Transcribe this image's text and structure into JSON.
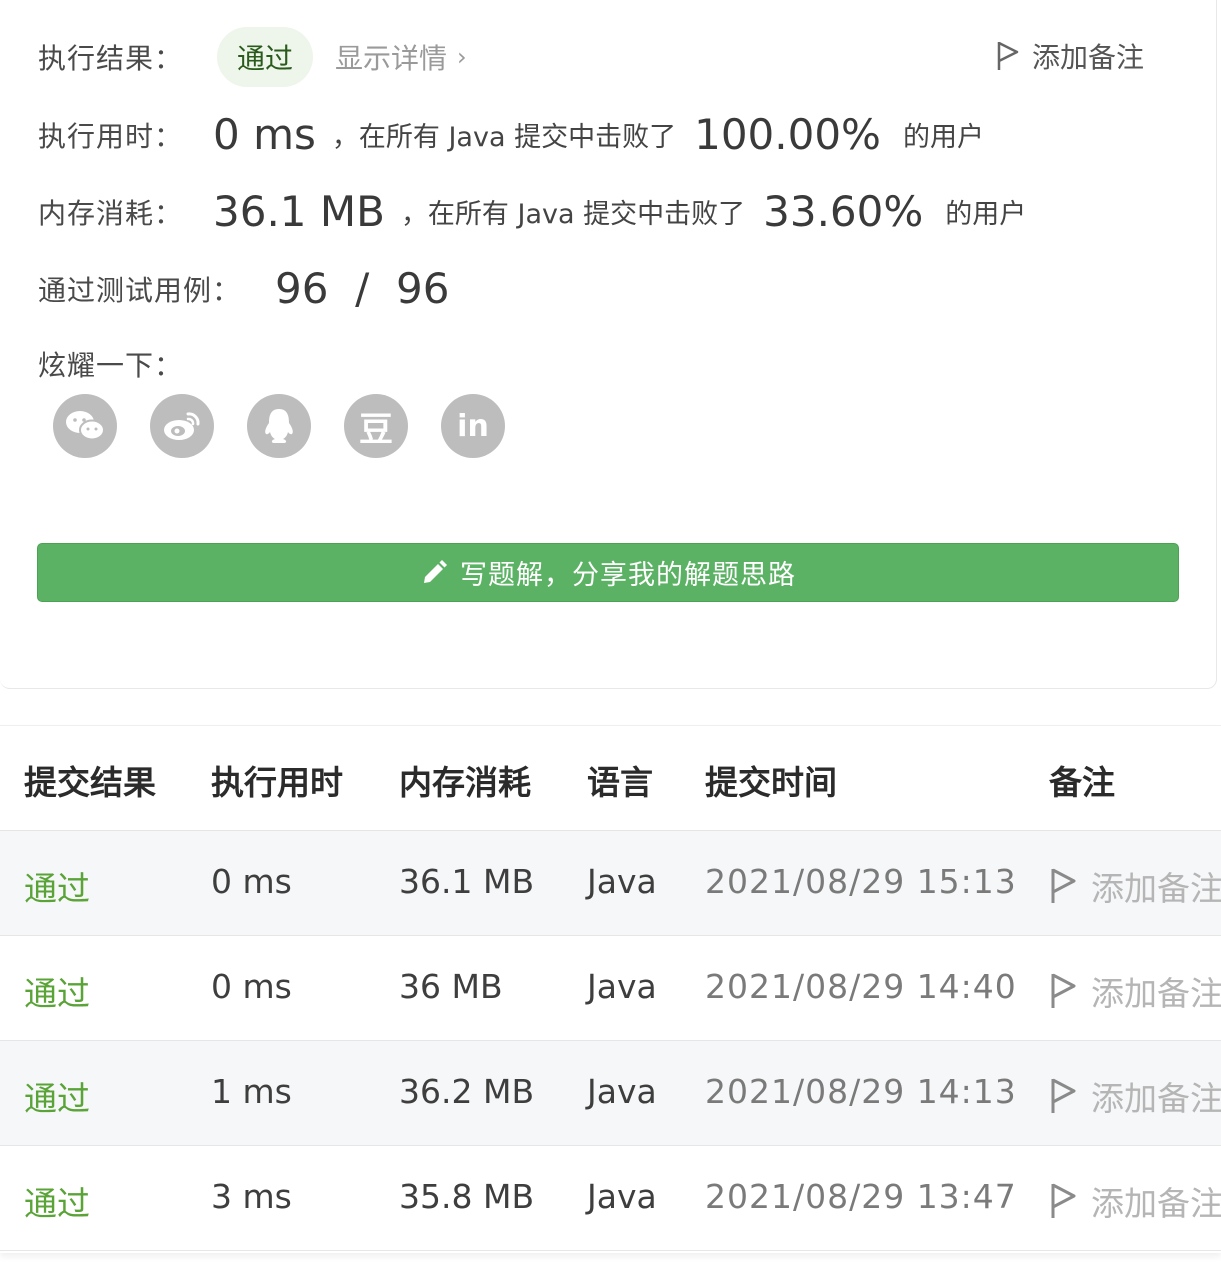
{
  "result": {
    "label": "执行结果：",
    "status": "通过",
    "details_link": "显示详情",
    "details_chevron": "›",
    "add_note": "添加备注"
  },
  "runtime": {
    "label": "执行用时：",
    "value": "0 ms",
    "mid_text": "，在所有 Java 提交中击败了",
    "percent": "100.00%",
    "suffix": "的用户"
  },
  "memory": {
    "label": "内存消耗：",
    "value": "36.1 MB",
    "mid_text": "，在所有 Java 提交中击败了",
    "percent": "33.60%",
    "suffix": "的用户"
  },
  "testcases": {
    "label": "通过测试用例：",
    "value": "96  /  96"
  },
  "share": {
    "label": "炫耀一下：",
    "icons": [
      "wechat-icon",
      "weibo-icon",
      "qq-icon",
      "douban-icon",
      "linkedin-icon"
    ],
    "douban_glyph": "豆",
    "linkedin_glyph": "in"
  },
  "write_solution": {
    "label": "写题解，分享我的解题思路"
  },
  "colors": {
    "accent": "#5cb264",
    "status_pass": "#5aa337",
    "icon_gray": "#bdbdbd"
  },
  "table": {
    "headers": [
      "提交结果",
      "执行用时",
      "内存消耗",
      "语言",
      "提交时间",
      "备注"
    ],
    "rows": [
      {
        "status": "通过",
        "runtime": "0 ms",
        "memory": "36.1 MB",
        "language": "Java",
        "time": "2021/08/29 15:13",
        "note": "添加备注"
      },
      {
        "status": "通过",
        "runtime": "0 ms",
        "memory": "36 MB",
        "language": "Java",
        "time": "2021/08/29 14:40",
        "note": "添加备注"
      },
      {
        "status": "通过",
        "runtime": "1 ms",
        "memory": "36.2 MB",
        "language": "Java",
        "time": "2021/08/29 14:13",
        "note": "添加备注"
      },
      {
        "status": "通过",
        "runtime": "3 ms",
        "memory": "35.8 MB",
        "language": "Java",
        "time": "2021/08/29 13:47",
        "note": "添加备注"
      }
    ]
  }
}
